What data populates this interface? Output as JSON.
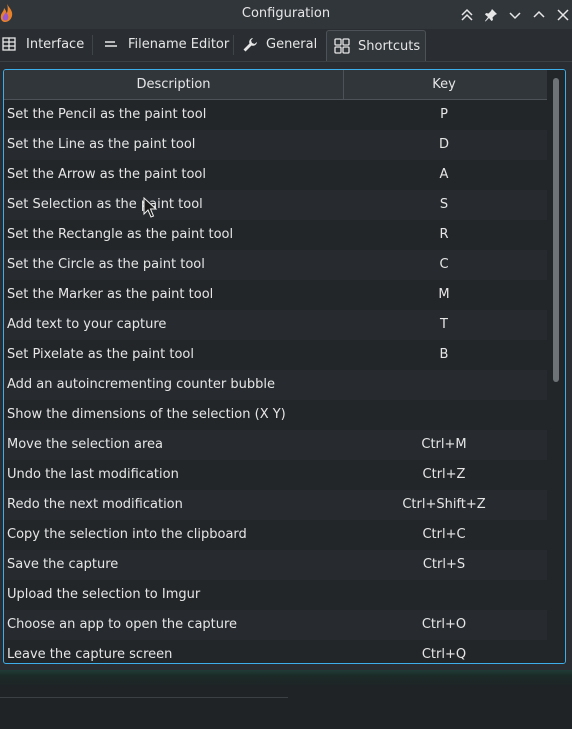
{
  "window": {
    "title": "Configuration"
  },
  "tabs": [
    {
      "label": "Interface",
      "icon": "interface-icon"
    },
    {
      "label": "Filename Editor",
      "icon": "filename-editor-icon"
    },
    {
      "label": "General",
      "icon": "wrench-icon"
    },
    {
      "label": "Shortcuts",
      "icon": "shortcuts-icon",
      "active": true
    }
  ],
  "table": {
    "columns": [
      "Description",
      "Key"
    ],
    "rows": [
      {
        "description": "Set the Pencil as the paint tool",
        "key": "P"
      },
      {
        "description": "Set the Line as the paint tool",
        "key": "D"
      },
      {
        "description": "Set the Arrow as the paint tool",
        "key": "A"
      },
      {
        "description": "Set Selection as the paint tool",
        "key": "S"
      },
      {
        "description": "Set the Rectangle as the paint tool",
        "key": "R"
      },
      {
        "description": "Set the Circle as the paint tool",
        "key": "C"
      },
      {
        "description": "Set the Marker as the paint tool",
        "key": "M"
      },
      {
        "description": "Add text to your capture",
        "key": "T"
      },
      {
        "description": "Set Pixelate as the paint tool",
        "key": "B"
      },
      {
        "description": "Add an autoincrementing counter bubble",
        "key": ""
      },
      {
        "description": "Show the dimensions of the selection (X Y)",
        "key": ""
      },
      {
        "description": "Move the selection area",
        "key": "Ctrl+M"
      },
      {
        "description": "Undo the last modification",
        "key": "Ctrl+Z"
      },
      {
        "description": "Redo the next modification",
        "key": "Ctrl+Shift+Z"
      },
      {
        "description": "Copy the selection into the clipboard",
        "key": "Ctrl+C"
      },
      {
        "description": "Save the capture",
        "key": "Ctrl+S"
      },
      {
        "description": "Upload the selection to Imgur",
        "key": ""
      },
      {
        "description": "Choose an app to open the capture",
        "key": "Ctrl+O"
      },
      {
        "description": "Leave the capture screen",
        "key": "Ctrl+Q"
      }
    ]
  },
  "colors": {
    "accent": "#3daee9",
    "background": "#2a2e32",
    "text": "#e6e6e6"
  }
}
